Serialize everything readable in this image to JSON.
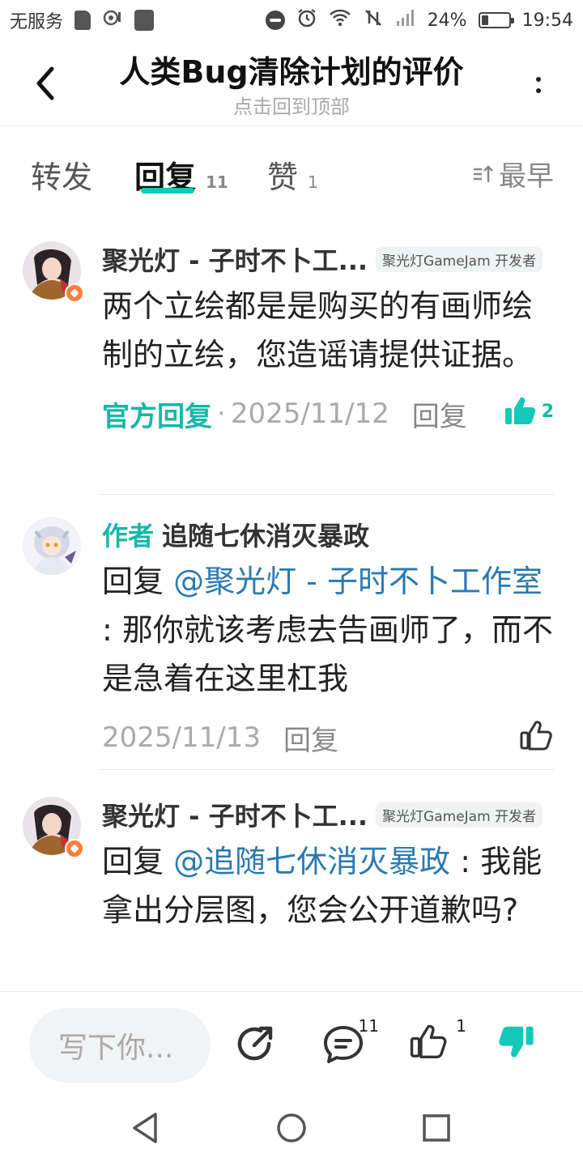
{
  "status_bar": {
    "carrier": "无服务",
    "battery": "24%",
    "time": "19:54"
  },
  "header": {
    "title": "人类Bug清除计划的评价",
    "subtitle": "点击回到顶部"
  },
  "tabs": [
    {
      "label": "转发",
      "count": ""
    },
    {
      "label": "回复",
      "count": "11"
    },
    {
      "label": "赞",
      "count": "1"
    }
  ],
  "sort_label": "最早",
  "comments": [
    {
      "name": "聚光灯 - 子时不卜工...",
      "badge": "聚光灯GameJam 开发者",
      "content": "两个立绘都是是购买的有画师绘制的立绘，您造谣请提供证据。",
      "official_label": "官方回复",
      "date": "2025/11/12",
      "reply_label": "回复",
      "likes": "2"
    },
    {
      "author_tag": "作者",
      "name": "追随七休消灭暴政",
      "reply_prefix": "回复 ",
      "mention": "@聚光灯 - 子时不卜工作室",
      "content": " : 那你就该考虑去告画师了，而不是急着在这里杠我",
      "date": "2025/11/13",
      "reply_label": "回复"
    },
    {
      "name": "聚光灯 - 子时不卜工...",
      "badge": "聚光灯GameJam 开发者",
      "reply_prefix": "回复 ",
      "mention": "@追随七休消灭暴政",
      "content": " : 我能拿出分层图，您会公开道歉吗?"
    }
  ],
  "bottom_bar": {
    "input_placeholder": "写下你...",
    "comment_count": "11",
    "like_count": "1"
  },
  "colors": {
    "accent": "#14c9b7",
    "mention": "#2a7ab0",
    "badge_orange": "#ff7e3d"
  }
}
